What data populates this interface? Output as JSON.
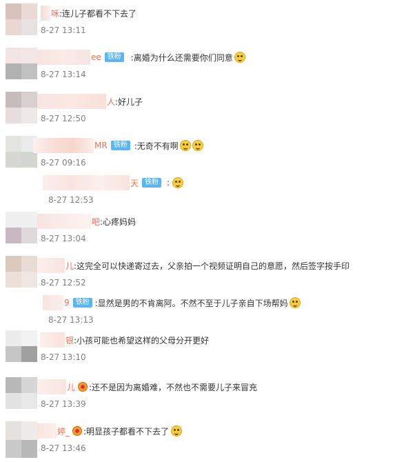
{
  "comments": [
    {
      "name_tail": "咊",
      "badge": "",
      "text": ":连儿子都看不下去了",
      "time": "8-27 13:11"
    },
    {
      "name_tail": "ee",
      "badge": "铁粉",
      "text": ":离婚为什么还需要你们同意",
      "time": "8-27 13:14"
    },
    {
      "name_tail": "人",
      "badge": "",
      "text": ":好儿子",
      "time": "8-27 12:50"
    },
    {
      "name_tail": "MR",
      "badge": "铁粉",
      "text": ":无奇不有啊",
      "time": "8-27 09:16"
    },
    {
      "name_tail": "天",
      "badge": "铁粉",
      "text": ":",
      "time": "8-27 12:53"
    },
    {
      "name_tail": "吧",
      "badge": "",
      "text": ":心疼妈妈",
      "time": "8-27 13:04"
    },
    {
      "name_tail": "儿",
      "badge": "",
      "text": ":这完全可以快递寄过去，父亲拍一个视频证明自己的意愿，然后签字按手印",
      "time": "8-27 12:52"
    },
    {
      "name_tail": "9",
      "badge": "铁粉",
      "text": ":显然是男的不肯离阿。不然不至于儿子亲自下场帮妈",
      "time": "8-27 13:13"
    },
    {
      "name_tail": "银",
      "badge": "",
      "text": ":小孩可能也希望这样的父母分开更好",
      "time": "8-27 13:10"
    },
    {
      "name_tail": "儿",
      "badge": "",
      "text": ":还不是因为离婚难，不然也不需要儿子来冒充",
      "time": "8-27 13:39"
    },
    {
      "name_tail": "婷_",
      "badge": "",
      "text": ":明显孩子都看不下去了",
      "time": "8-27 13:46"
    }
  ],
  "colors": {
    "name": "#eb7350",
    "badge_bg": "#5bb5f3",
    "text": "#333333",
    "time": "#808080"
  },
  "icons": [
    "laugh-cry-emoji",
    "laugh-emoji",
    "smile-emoji",
    "crying-emoji",
    "medal-icon"
  ]
}
